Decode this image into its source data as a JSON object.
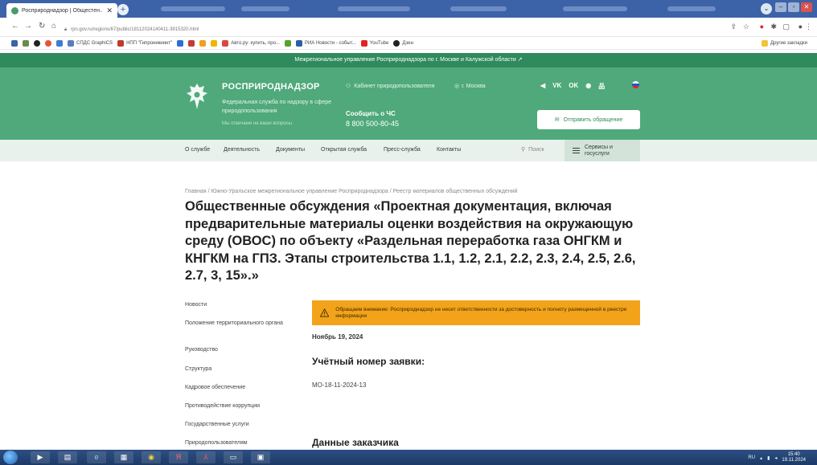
{
  "browser": {
    "tab_title": "Росприроднадзор | Общестен...",
    "new_tab_glyph": "+",
    "url": "rpn.gov.ru/regions/67/public/18112024140411-3915320.html",
    "bookmarks": [
      {
        "label": "СПДС GraphiCS",
        "color": "#5a7fc0"
      },
      {
        "label": "НПП \"Гипроникиинт\"",
        "color": "#c03a2b"
      },
      {
        "label": "Авто.ру: купить, про...",
        "color": "#d44"
      },
      {
        "label": "РИА Новости - событ...",
        "color": "#2b5ea8"
      },
      {
        "label": "YouTube",
        "color": "#e02424"
      },
      {
        "label": "Дзен",
        "color": "#222"
      }
    ],
    "other_bookmarks": "Другие закладки",
    "icons": {
      "back": "back-arrow-icon",
      "forward": "forward-arrow-icon",
      "reload": "reload-icon",
      "home": "home-icon"
    }
  },
  "site": {
    "top_strip": "Межрегиональное управление Росприроднадзора по г. Москве и Калужской области",
    "brand": "РОСПРИРОДНАДЗОР",
    "brand_sub": "Федеральная служба по надзору в сфере природопользования",
    "brand_note": "Мы отвечаем на ваши вопросы",
    "cabinet": "Кабинет природопользователя",
    "city": "г. Москва",
    "report_label": "Сообщить о ЧС",
    "report_phone": "8 800 500-80-45",
    "socials": [
      "◀",
      "VK",
      "OK",
      "◉",
      "品"
    ],
    "send_button": "Отправить обращение",
    "nav": [
      "О службе",
      "Деятельность",
      "Документы",
      "Открытая служба",
      "Пресс-служба",
      "Контакты"
    ],
    "search_label": "Поиск",
    "services_label_1": "Сервисы и",
    "services_label_2": "госуслуги"
  },
  "page": {
    "breadcrumb": "Главная / Южно-Уральское межрегиональное управление Росприроднадзора / Реестр материалов общественных обсуждений",
    "title": "Общественные обсуждения «Проектная документация, включая предварительные материалы оценки воздействия на окружающую среду (ОВОС) по объекту «Раздельная переработка газа ОНГКМ и КНГКМ на ГПЗ. Этапы строительства 1.1, 1.2, 2.1, 2.2, 2.3, 2.4, 2.5, 2.6, 2.7, 3, 15».»",
    "sidebar": [
      "Новости",
      "Положение территориального органа",
      "Руководство",
      "Структура",
      "Кадровое обеспечение",
      "Противодействие коррупции",
      "Государственные услуги",
      "Природопользователям"
    ],
    "warning": "Обращаем внимание: Росприроднадзор не несет ответственности за достоверность и полноту размещенной в реестре информации",
    "date": "Ноябрь 19, 2024",
    "account_heading": "Учётный номер заявки:",
    "account_value": "МО-18-11-2024-13",
    "customer_heading": "Данные заказчика"
  },
  "taskbar": {
    "tray_lang": "RU",
    "time": "15:40",
    "date": "19.11.2024"
  },
  "colors": {
    "brand_green": "#4fa97a",
    "strip_green": "#2f8a5d",
    "warning_orange": "#f2a31a"
  }
}
